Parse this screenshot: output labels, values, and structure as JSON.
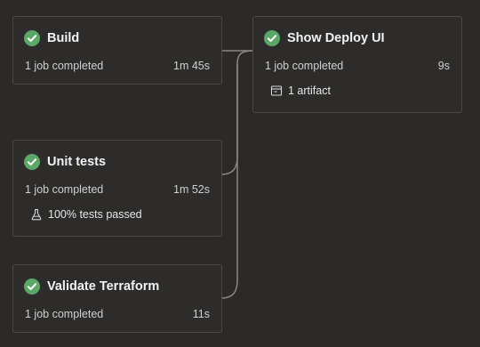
{
  "colors": {
    "background": "#2b2a28",
    "card_border": "#4a4947",
    "success": "#5ba768",
    "connector": "#8a8886"
  },
  "stages": {
    "build": {
      "title": "Build",
      "status_icon": "check-circle-icon",
      "jobs": "1 job completed",
      "duration": "1m 45s"
    },
    "unit_tests": {
      "title": "Unit tests",
      "status_icon": "check-circle-icon",
      "jobs": "1 job completed",
      "duration": "1m 52s",
      "detail_icon": "flask-icon",
      "detail": "100% tests passed"
    },
    "validate_terraform": {
      "title": "Validate Terraform",
      "status_icon": "check-circle-icon",
      "jobs": "1 job completed",
      "duration": "11s"
    },
    "show_deploy_ui": {
      "title": "Show Deploy UI",
      "status_icon": "check-circle-icon",
      "jobs": "1 job completed",
      "duration": "9s",
      "detail_icon": "artifact-icon",
      "detail": "1 artifact"
    }
  }
}
